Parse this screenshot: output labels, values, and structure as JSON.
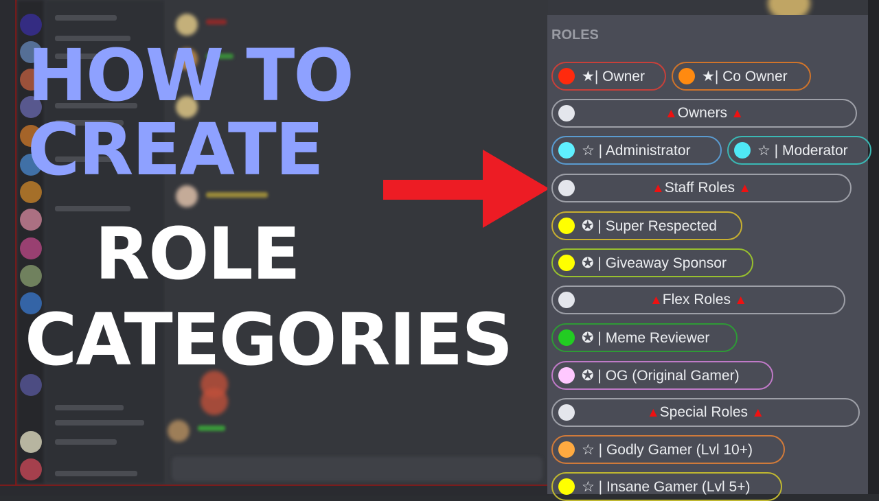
{
  "thumbnail": {
    "title_lines": [
      "HOW TO",
      "CREATE",
      "ROLE",
      "CATEGORIES"
    ],
    "title_colors": {
      "accent": "#8ea1ff",
      "primary": "#ffffff"
    },
    "arrow_color": "#ed1c24"
  },
  "roles_panel": {
    "heading": "ROLES",
    "roles": [
      {
        "label": "★| Owner",
        "color": "#ff2a0d",
        "border": "#c8403a",
        "type": "role"
      },
      {
        "label": "★| Co Owner",
        "color": "#ff8a10",
        "border": "#d0742a",
        "type": "role"
      },
      {
        "label": "Owners",
        "color": "#e4e6ec",
        "border": "#9ea0a8",
        "type": "category"
      },
      {
        "label": "☆ | Administrator",
        "color": "#5ff0ff",
        "border": "#5a9bd0",
        "type": "role"
      },
      {
        "label": "☆ | Moderator",
        "color": "#4fe8f5",
        "border": "#3ab9b5",
        "type": "role"
      },
      {
        "label": "Staff Roles",
        "color": "#e4e6ec",
        "border": "#9ea0a8",
        "type": "category"
      },
      {
        "label": "✪ | Super Respected",
        "color": "#ffff00",
        "border": "#c8b030",
        "type": "role"
      },
      {
        "label": "✪ | Giveaway Sponsor",
        "color": "#ffff00",
        "border": "#98c02e",
        "type": "role"
      },
      {
        "label": "Flex Roles",
        "color": "#e4e6ec",
        "border": "#9ea0a8",
        "type": "category"
      },
      {
        "label": "✪ | Meme Reviewer",
        "color": "#22cc22",
        "border": "#2e9a36",
        "type": "role"
      },
      {
        "label": "✪ | OG (Original Gamer)",
        "color": "#ffc8ff",
        "border": "#c07ac8",
        "type": "role"
      },
      {
        "label": "Special Roles",
        "color": "#e4e6ec",
        "border": "#9ea0a8",
        "type": "category"
      },
      {
        "label": "☆ | Godly Gamer (Lvl 10+)",
        "color": "#ffaa40",
        "border": "#d07a3a",
        "type": "role"
      },
      {
        "label": "☆ | Insane Gamer (Lvl 5+)",
        "color": "#ffff00",
        "border": "#c0b830",
        "type": "role"
      }
    ],
    "category_marker": "▲"
  }
}
